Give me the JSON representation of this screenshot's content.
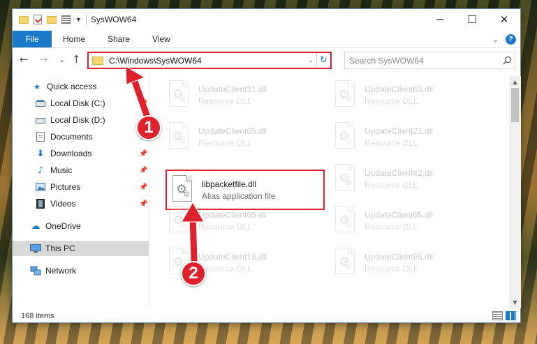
{
  "window": {
    "title": "SysWOW64",
    "minimize_glyph": "─",
    "maximize_glyph": "☐",
    "close_glyph": "✕"
  },
  "ribbon": {
    "tabs": [
      {
        "label": "File",
        "active": true
      },
      {
        "label": "Home"
      },
      {
        "label": "Share"
      },
      {
        "label": "View"
      }
    ],
    "expand_glyph": "⌄",
    "help_label": "?"
  },
  "navigation": {
    "back_glyph": "←",
    "forward_glyph": "→",
    "recent_glyph": "⌄",
    "up_glyph": "↑",
    "address_path": "C:\\Windows\\SysWOW64",
    "address_dropdown_glyph": "⌄",
    "refresh_glyph": "↻",
    "search_placeholder": "Search SysWOW64"
  },
  "sidebar": {
    "items": [
      {
        "label": "Quick access",
        "icon": "star-icon",
        "pinned": false
      },
      {
        "label": "Local Disk (C:)",
        "icon": "drive-icon",
        "pinned": true
      },
      {
        "label": "Local Disk (D:)",
        "icon": "drive-icon",
        "pinned": true
      },
      {
        "label": "Documents",
        "icon": "documents-icon",
        "pinned": true
      },
      {
        "label": "Downloads",
        "icon": "download-icon",
        "pinned": true
      },
      {
        "label": "Music",
        "icon": "music-icon",
        "pinned": true
      },
      {
        "label": "Pictures",
        "icon": "pictures-icon",
        "pinned": true
      },
      {
        "label": "Videos",
        "icon": "videos-icon",
        "pinned": true
      },
      {
        "label": "OneDrive",
        "icon": "cloud-icon",
        "pinned": false
      },
      {
        "label": "This PC",
        "icon": "computer-icon",
        "pinned": false,
        "selected": true
      },
      {
        "label": "Network",
        "icon": "network-icon",
        "pinned": false
      }
    ],
    "pin_glyph": "📌"
  },
  "files": [
    {
      "name": "UpdateClient21.dll",
      "type": "Resource DLL",
      "faded": true
    },
    {
      "name": "UpdateClient63.dll",
      "type": "Resource DLL",
      "faded": true
    },
    {
      "name": "UpdateClient65.dll",
      "type": "Resource DLL",
      "faded": true
    },
    {
      "name": "UpdateClient21.dll",
      "type": "Resource DLL",
      "faded": true
    },
    {
      "name": "libpacketfile.dll",
      "type": "Alias application file",
      "faded": false,
      "highlighted": true
    },
    {
      "name": "UpdateClient42.dll",
      "type": "Resource DLL",
      "faded": true
    },
    {
      "name": "UpdateClient65.dll",
      "type": "Resource DLL",
      "faded": true
    },
    {
      "name": "UpdateClient65.dll",
      "type": "Resource DLL",
      "faded": true
    },
    {
      "name": "UpdateClient19.dll",
      "type": "Resource DLL",
      "faded": true
    },
    {
      "name": "UpdateClient65.dll",
      "type": "Resource DLL",
      "faded": true
    }
  ],
  "scrollbar": {
    "up_glyph": "▲",
    "down_glyph": "▼",
    "position": 0.0
  },
  "status": {
    "item_count": "168 items"
  },
  "annotations": {
    "step1": "1",
    "step2": "2",
    "color": "#e0202a"
  }
}
